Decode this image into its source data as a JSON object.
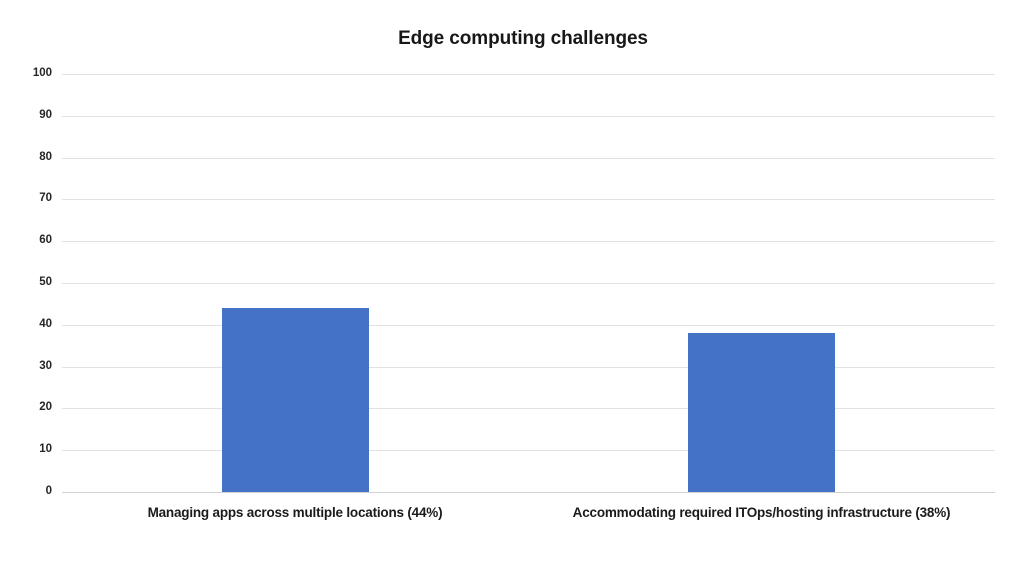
{
  "chart_data": {
    "type": "bar",
    "title": "Edge computing challenges",
    "xlabel": "",
    "ylabel": "",
    "categories": [
      "Managing apps across multiple locations (44%)",
      "Accommodating required ITOps/hosting infrastructure (38%)"
    ],
    "values": [
      44,
      38
    ],
    "ylim": [
      0,
      100
    ],
    "yticks": [
      100,
      90,
      80,
      70,
      60,
      50,
      40,
      30,
      20,
      10,
      0
    ],
    "ytick_labels": [
      "100",
      "90",
      "80",
      "70",
      "60",
      "50",
      "40",
      "30",
      "20",
      "10",
      "0"
    ],
    "grid": true,
    "legend": false,
    "series_color": "#4472C4",
    "gridline_color": "#E2E2E2",
    "background_color": "#FFFFFF"
  }
}
